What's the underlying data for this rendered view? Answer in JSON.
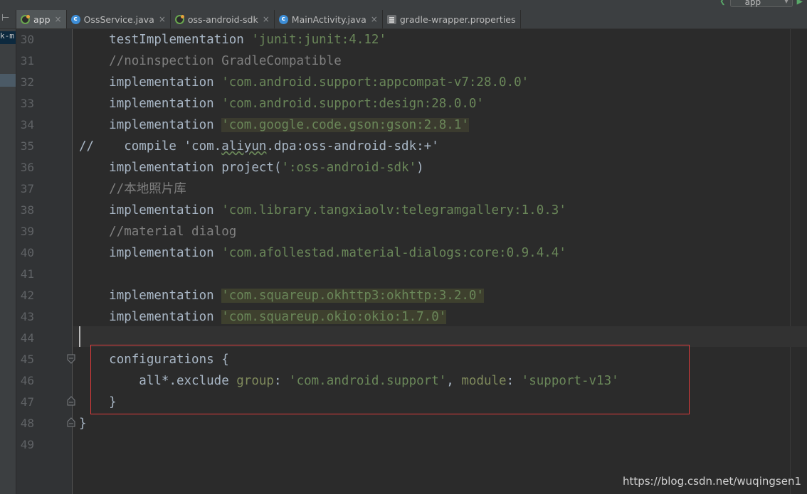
{
  "tabs": [
    {
      "label": "app",
      "icon": "gradle-icon",
      "active": true
    },
    {
      "label": "OssService.java",
      "icon": "java-class-icon",
      "active": false
    },
    {
      "label": "oss-android-sdk",
      "icon": "gradle-icon",
      "active": false
    },
    {
      "label": "MainActivity.java",
      "icon": "java-class-icon",
      "active": false
    },
    {
      "label": "gradle-wrapper.properties",
      "icon": "properties-file-icon",
      "active": false
    }
  ],
  "tab_close_glyph": "×",
  "run_config": {
    "label": "app"
  },
  "project_strip": {
    "text": "k-m"
  },
  "line_numbers": [
    "30",
    "31",
    "32",
    "33",
    "34",
    "35",
    "36",
    "37",
    "38",
    "39",
    "40",
    "41",
    "42",
    "43",
    "44",
    "45",
    "46",
    "47",
    "48",
    "49"
  ],
  "code": {
    "l30": {
      "kw": "testImplementation ",
      "str": "'junit:junit:4.12'"
    },
    "l31": {
      "cmt": "//noinspection GradleCompatible"
    },
    "l32": {
      "kw": "implementation ",
      "str": "'com.android.support:appcompat-v7:28.0.0'"
    },
    "l33": {
      "kw": "implementation ",
      "str": "'com.android.support:design:28.0.0'"
    },
    "l34": {
      "kw": "implementation ",
      "str": "'com.google.code.gson:gson:2.8.1'"
    },
    "l35": {
      "a": "//    compile 'com.",
      "b": "aliyun",
      "c": ".dpa:oss-android-sdk:+'"
    },
    "l36": {
      "kw": "implementation project(",
      "str": "':oss-android-sdk'",
      "end": ")"
    },
    "l37": {
      "cmt": "//本地照片库"
    },
    "l38": {
      "kw": "implementation ",
      "str": "'com.library.tangxiaolv:telegramgallery:1.0.3'"
    },
    "l39": {
      "cmt": "//material dialog"
    },
    "l40": {
      "kw": "implementation ",
      "str": "'com.afollestad.material-dialogs:core:0.9.4.4'"
    },
    "l42": {
      "kw": "implementation ",
      "str": "'com.squareup.okhttp3:okhttp:3.2.0'"
    },
    "l43": {
      "kw": "implementation ",
      "str": "'com.squareup.okio:okio:1.7.0'"
    },
    "l45": {
      "kw": "configurations {"
    },
    "l46": {
      "a": "all*.exclude ",
      "p1": "group",
      "b": ": ",
      "s1": "'com.android.support'",
      "c": ", ",
      "p2": "module",
      "d": ": ",
      "s2": "'support-v13'"
    },
    "l47": {
      "kw": "}"
    },
    "l48": {
      "kw": "}"
    }
  },
  "watermark": "https://blog.csdn.net/wuqingsen1",
  "colors": {
    "background": "#2b2b2b",
    "string": "#6a8759",
    "comment": "#808080",
    "highlight_box": "#e03c3c"
  }
}
